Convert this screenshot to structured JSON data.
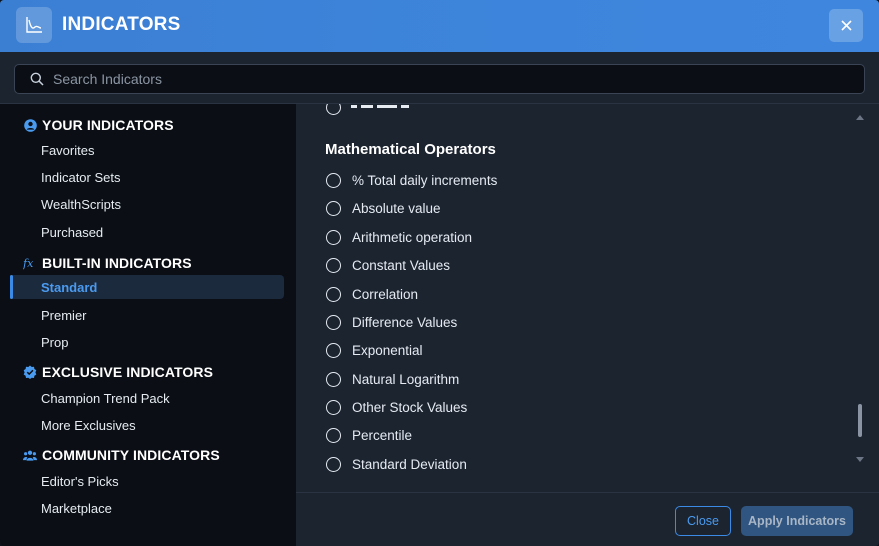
{
  "header": {
    "title": "INDICATORS",
    "icon": "chart-line-icon",
    "close_icon": "close-icon"
  },
  "search": {
    "placeholder": "Search Indicators",
    "value": ""
  },
  "sidebar": {
    "sections": [
      {
        "label": "YOUR INDICATORS",
        "icon": "user-circle-icon",
        "items": [
          "Favorites",
          "Indicator Sets",
          "WealthScripts",
          "Purchased"
        ]
      },
      {
        "label": "BUILT-IN INDICATORS",
        "icon": "fx-icon",
        "items": [
          "Standard",
          "Premier",
          "Prop"
        ]
      },
      {
        "label": "EXCLUSIVE INDICATORS",
        "icon": "verified-badge-icon",
        "items": [
          "Champion Trend Pack",
          "More Exclusives"
        ]
      },
      {
        "label": "COMMUNITY INDICATORS",
        "icon": "users-icon",
        "items": [
          "Editor's Picks",
          "Marketplace"
        ]
      }
    ],
    "active_item": "Standard"
  },
  "content": {
    "category_title": "Mathematical Operators",
    "options": [
      "% Total daily increments",
      "Absolute value",
      "Arithmetic operation",
      "Constant Values",
      "Correlation",
      "Difference Values",
      "Exponential",
      "Natural Logarithm",
      "Other Stock Values",
      "Percentile",
      "Standard Deviation"
    ]
  },
  "footer": {
    "close_label": "Close",
    "apply_label": "Apply Indicators"
  },
  "colors": {
    "accent": "#3b8ae6",
    "header": "#3d85dc",
    "sidebar_bg": "#0b0f15",
    "content_bg": "#1c2430"
  }
}
